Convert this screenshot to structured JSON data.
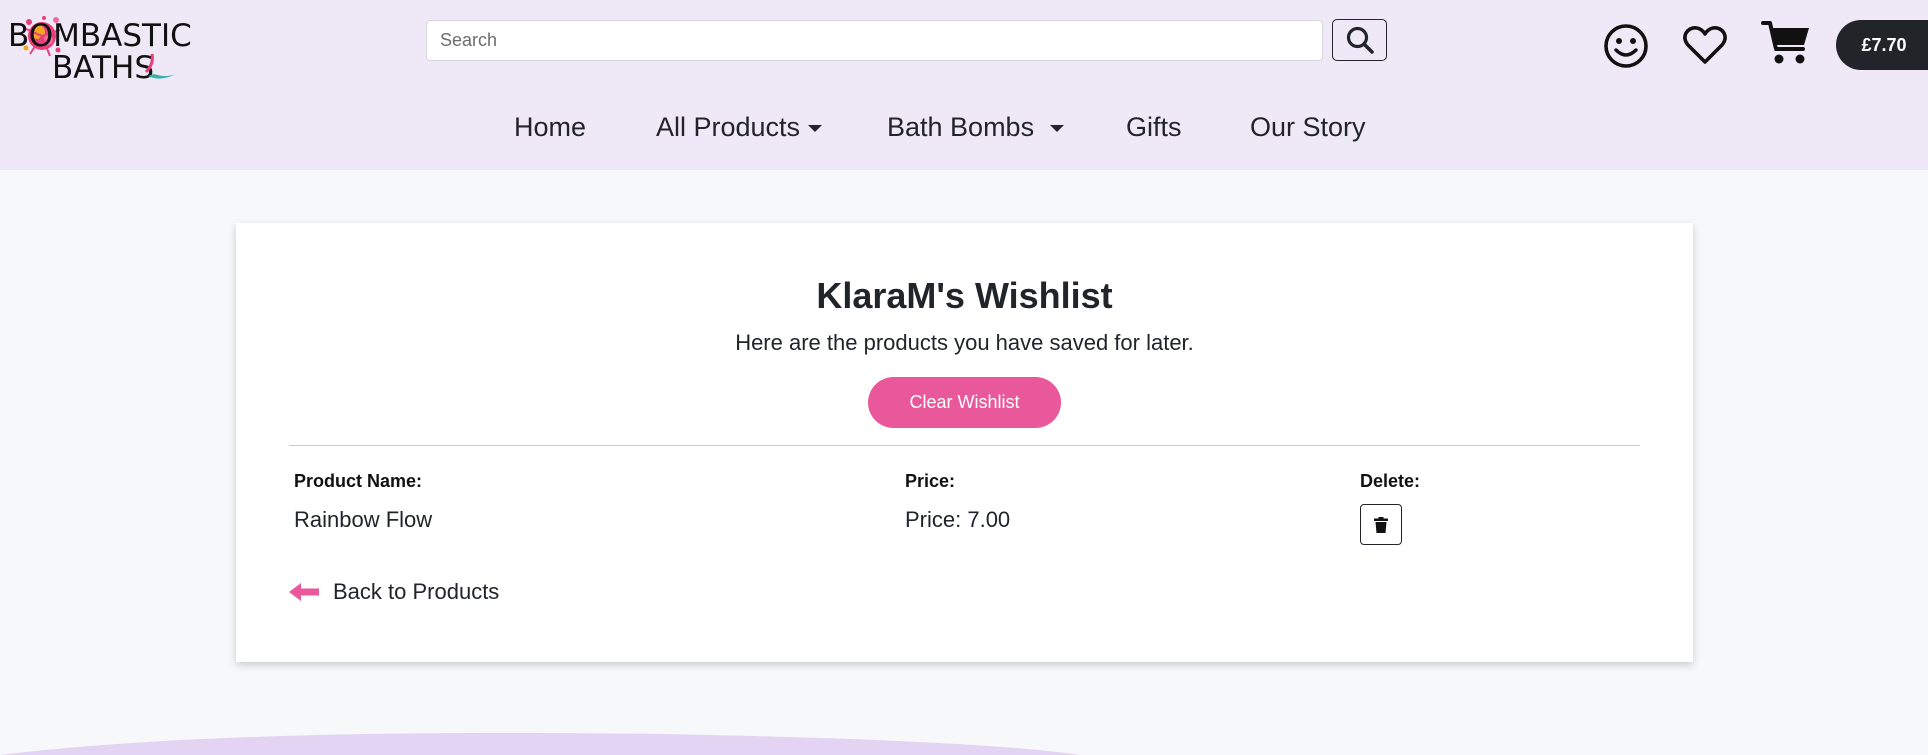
{
  "brand": {
    "name_line1": "BOMBASTIC",
    "name_line2": "BATHS"
  },
  "search": {
    "placeholder": "Search"
  },
  "header": {
    "basket_total": "£7.70"
  },
  "nav": {
    "items": [
      {
        "label": "Home"
      },
      {
        "label": "All Products"
      },
      {
        "label": "Bath Bombs"
      },
      {
        "label": "Gifts"
      },
      {
        "label": "Our Story"
      }
    ]
  },
  "wishlist": {
    "title": "KlaraM's Wishlist",
    "subtitle": "Here are the products you have saved for later.",
    "clear_label": "Clear Wishlist",
    "columns": {
      "name": "Product Name:",
      "price": "Price:",
      "delete": "Delete:"
    },
    "items": [
      {
        "name": "Rainbow Flow",
        "price": "Price: 7.00"
      }
    ],
    "back_label": "Back to Products"
  },
  "colors": {
    "header_bg": "#efe9f7",
    "accent_pink": "#e9589a",
    "dark": "#212529",
    "footer_wave": "#e3d4f3"
  },
  "icons": {
    "search": "search-icon",
    "account": "smiley-icon",
    "wishlist": "heart-icon",
    "cart": "cart-icon",
    "delete": "trash-icon",
    "back": "arrow-left-icon"
  }
}
